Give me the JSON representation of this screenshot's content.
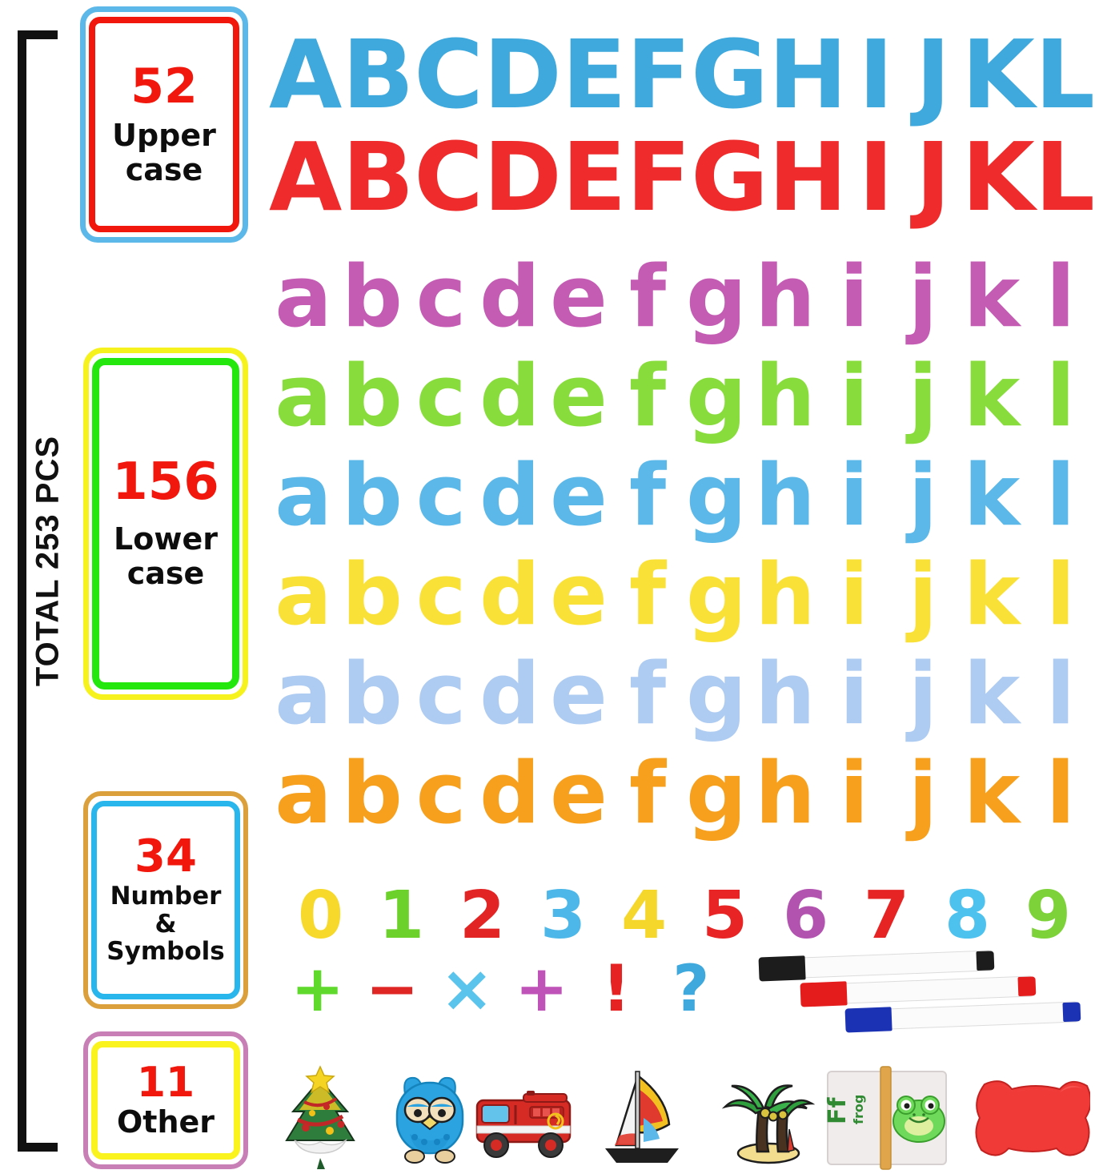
{
  "total": {
    "label": "TOTAL 253 PCS"
  },
  "categories": [
    {
      "id": "upper",
      "count": "52",
      "name": "Upper\ncase",
      "line1": "Upper",
      "line2": "case",
      "outer_color": "#5bb8e8",
      "inner_color": "#f2170c",
      "count_color": "#f2170c"
    },
    {
      "id": "lower",
      "count": "156",
      "name": "Lower case",
      "line1": "Lower",
      "line2": "case",
      "outer_color": "#f6f21e",
      "inner_color": "#24e80d",
      "count_color": "#f2170c"
    },
    {
      "id": "numsym",
      "count": "34",
      "name": "Number & Symbols",
      "line1": "Number",
      "line2": "&",
      "line3": "Symbols",
      "outer_color": "#dba03c",
      "inner_color": "#29b6ec",
      "count_color": "#f2170c"
    },
    {
      "id": "other",
      "count": "11",
      "name": "Other",
      "line1": "Other",
      "outer_color": "#c77fb5",
      "inner_color": "#fbf31d",
      "count_color": "#f2170c"
    }
  ],
  "uppercase_rows": [
    {
      "color": "#3fa9dd",
      "letters": [
        "A",
        "B",
        "C",
        "D",
        "E",
        "F",
        "G",
        "H",
        "I",
        "J",
        "K",
        "L"
      ]
    },
    {
      "color": "#ef2b2b",
      "letters": [
        "A",
        "B",
        "C",
        "D",
        "E",
        "F",
        "G",
        "H",
        "I",
        "J",
        "K",
        "L"
      ]
    }
  ],
  "lowercase_rows": [
    {
      "color": "#c45cb4",
      "letters": [
        "a",
        "b",
        "c",
        "d",
        "e",
        "f",
        "g",
        "h",
        "i",
        "j",
        "k",
        "l"
      ]
    },
    {
      "color": "#88dd3c",
      "letters": [
        "a",
        "b",
        "c",
        "d",
        "e",
        "f",
        "g",
        "h",
        "i",
        "j",
        "k",
        "l"
      ]
    },
    {
      "color": "#5bb8e8",
      "letters": [
        "a",
        "b",
        "c",
        "d",
        "e",
        "f",
        "g",
        "h",
        "i",
        "j",
        "k",
        "l"
      ]
    },
    {
      "color": "#fae137",
      "letters": [
        "a",
        "b",
        "c",
        "d",
        "e",
        "f",
        "g",
        "h",
        "i",
        "j",
        "k",
        "l"
      ]
    },
    {
      "color": "#aecbf2",
      "letters": [
        "a",
        "b",
        "c",
        "d",
        "e",
        "f",
        "g",
        "h",
        "i",
        "j",
        "k",
        "l"
      ]
    },
    {
      "color": "#f6a01e",
      "letters": [
        "a",
        "b",
        "c",
        "d",
        "e",
        "f",
        "g",
        "h",
        "i",
        "j",
        "k",
        "l"
      ]
    }
  ],
  "numbers": [
    {
      "value": "0",
      "color": "#f6d92a"
    },
    {
      "value": "1",
      "color": "#6cd12a"
    },
    {
      "value": "2",
      "color": "#e22424"
    },
    {
      "value": "3",
      "color": "#4cb7e8"
    },
    {
      "value": "4",
      "color": "#f5d72b"
    },
    {
      "value": "5",
      "color": "#e82424"
    },
    {
      "value": "6",
      "color": "#b253b0"
    },
    {
      "value": "7",
      "color": "#e62424"
    },
    {
      "value": "8",
      "color": "#4ec2ef"
    },
    {
      "value": "9",
      "color": "#7ed239"
    }
  ],
  "symbols": [
    {
      "value": "+",
      "name": "plus",
      "color": "#5fd92b"
    },
    {
      "value": "−",
      "name": "minus",
      "color": "#e02525"
    },
    {
      "value": "×",
      "name": "multiply",
      "color": "#5bc4ec"
    },
    {
      "value": "+",
      "name": "plus-alt",
      "color": "#c053b8"
    },
    {
      "value": "!",
      "name": "exclamation",
      "color": "#e62222"
    },
    {
      "value": "?",
      "name": "question",
      "color": "#3fa8dc"
    }
  ],
  "markers": [
    {
      "name": "black-marker",
      "color": "#1c1c1c"
    },
    {
      "name": "red-marker",
      "color": "#e51c1c"
    },
    {
      "name": "blue-marker",
      "color": "#1c32b4"
    }
  ],
  "other_items": [
    {
      "name": "christmas-tree-magnet",
      "label": "Christmas tree"
    },
    {
      "name": "owl-magnet",
      "label": "Owl"
    },
    {
      "name": "fire-truck-magnet",
      "label": "Fire truck"
    },
    {
      "name": "sailboat-magnet",
      "label": "Sailboat"
    },
    {
      "name": "palm-tree-magnet",
      "label": "Palm tree"
    },
    {
      "name": "flash-card",
      "label": "Ff frog",
      "card_letter": "Ff",
      "card_word": "frog"
    },
    {
      "name": "eraser",
      "label": "Eraser"
    }
  ]
}
